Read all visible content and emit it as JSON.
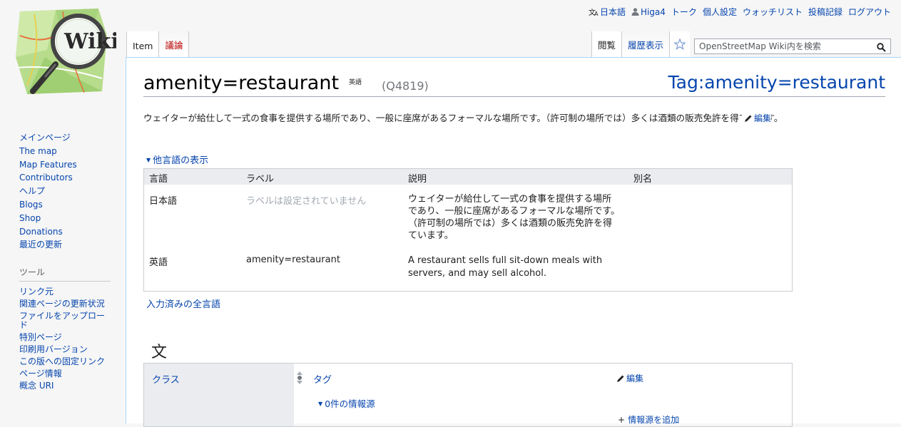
{
  "personal": {
    "language": "日本語",
    "user": "Higa4",
    "talk": "トーク",
    "preferences": "個人設定",
    "watchlist": "ウォッチリスト",
    "contributions": "投稿記録",
    "logout": "ログアウト"
  },
  "logo": {
    "text": "Wiki"
  },
  "sidebar": {
    "nav": [
      "メインページ",
      "The map",
      "Map Features",
      "Contributors",
      "ヘルプ",
      "Blogs",
      "Shop",
      "Donations",
      "最近の更新"
    ],
    "tools_heading": "ツール",
    "tools": [
      "リンク元",
      "関連ページの更新状況",
      "ファイルをアップロード",
      "特別ページ",
      "印刷用バージョン",
      "この版への固定リンク",
      "ページ情報",
      "概念 URI"
    ]
  },
  "tabs": {
    "item": "Item",
    "discussion": "議論",
    "read": "閲覧",
    "history": "履歴表示"
  },
  "search": {
    "placeholder": "OpenStreetMap Wiki内を検索"
  },
  "page": {
    "title": "amenity=restaurant",
    "title_lang": "英語",
    "qid": "(Q4819)",
    "tag_link": "Tag:amenity=restaurant",
    "description": "ウェイターが給仕して一式の食事を提供する場所であり、一般に座席があるフォーマルな場所です。（許可制の場所では）多くは酒類の販売免許を得ています。",
    "edit": "編集",
    "other_languages": "他言語の表示",
    "all_languages": "入力済みの全言語"
  },
  "lang_table": {
    "headers": [
      "言語",
      "ラベル",
      "説明",
      "別名"
    ],
    "rows": [
      {
        "language": "日本語",
        "label": "ラベルは設定されていません",
        "description": "ウェイターが給仕して一式の食事を提供する場所であり、一般に座席があるフォーマルな場所です。（許可制の場所では）多くは酒類の販売免許を得ています。",
        "aliases": ""
      },
      {
        "language": "英語",
        "label": "amenity=restaurant",
        "description": "A restaurant sells full sit-down meals with servers, and may sell alcohol.",
        "aliases": ""
      }
    ]
  },
  "statements": {
    "heading": "文",
    "property": "クラス",
    "value": "タグ",
    "edit": "編集",
    "references": "0件の情報源",
    "add_reference": "情報源を追加"
  },
  "colors": {
    "link": "#0645ad",
    "new_link": "#ba0000",
    "border": "#a7d7f9"
  }
}
